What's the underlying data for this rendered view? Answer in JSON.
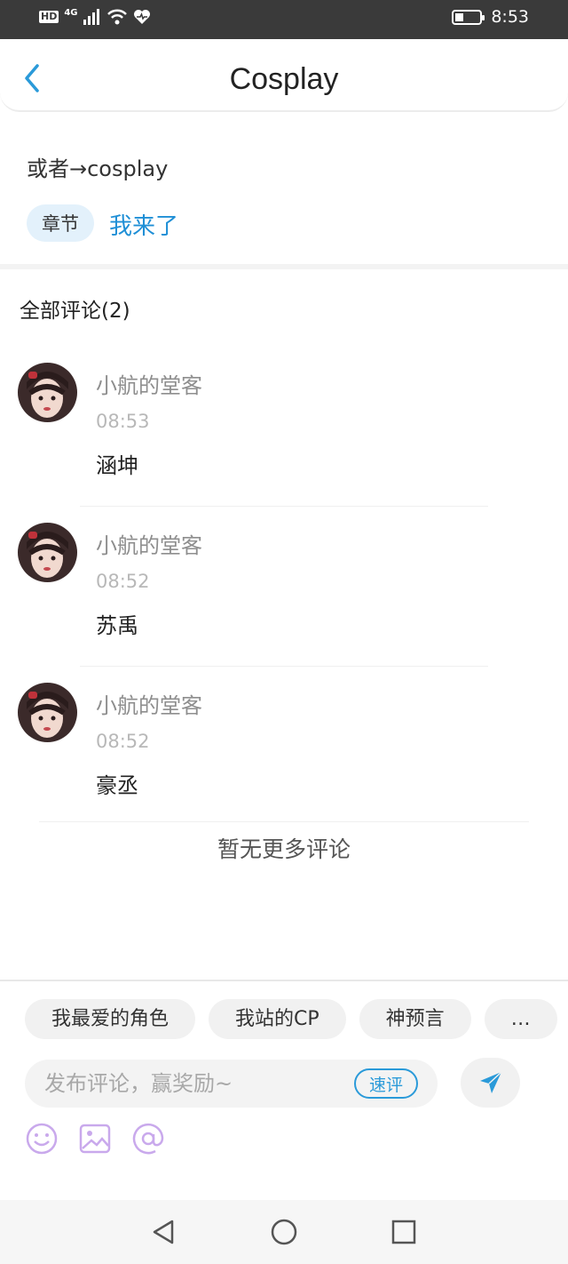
{
  "status_bar": {
    "hd": "HD",
    "network": "4G",
    "time": "8:53",
    "battery_level": 0.35
  },
  "header": {
    "title": "Cosplay"
  },
  "post": {
    "text": "或者→cosplay",
    "chapter_tag": "章节",
    "chapter_link": "我来了"
  },
  "comments": {
    "title": "全部评论(2)",
    "items": [
      {
        "name": "小航的堂客",
        "time": "08:53",
        "text": "涵坤"
      },
      {
        "name": "小航的堂客",
        "time": "08:52",
        "text": "苏禹"
      },
      {
        "name": "小航的堂客",
        "time": "08:52",
        "text": "豪丞"
      }
    ],
    "no_more": "暂无更多评论"
  },
  "composer": {
    "chips": [
      "我最爱的角色",
      "我站的CP",
      "神预言",
      "…"
    ],
    "placeholder": "发布评论，赢奖励~",
    "quick_label": "速评",
    "icons": [
      "emoji-icon",
      "image-icon",
      "mention-icon"
    ]
  },
  "colors": {
    "accent": "#1f8fd6",
    "tag_bg": "#e3f1fb",
    "status_bar": "#3a3a3a",
    "icon_purple": "#c9a9ec"
  }
}
